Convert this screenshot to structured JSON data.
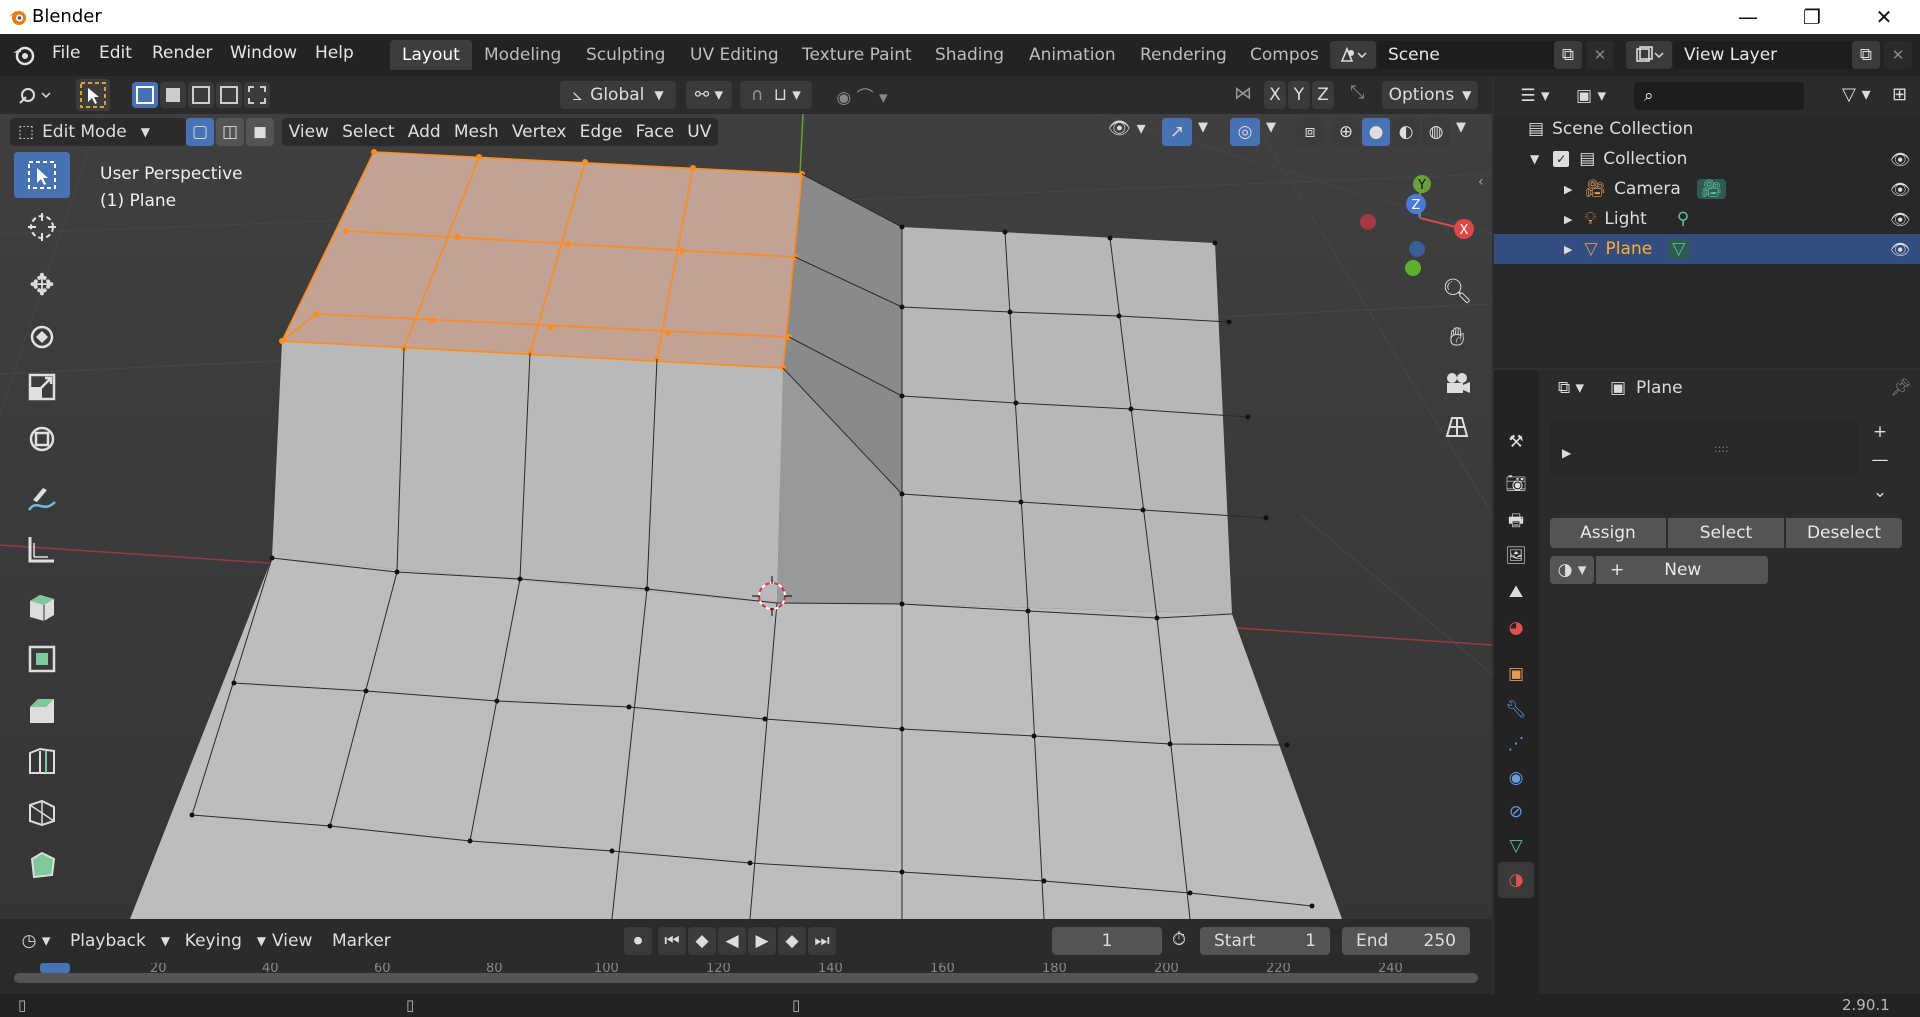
{
  "window": {
    "title": "Blender",
    "minimize": "—",
    "restore": "❐",
    "close": "✕"
  },
  "menu": [
    "File",
    "Edit",
    "Render",
    "Window",
    "Help"
  ],
  "workspaces": [
    "Layout",
    "Modeling",
    "Sculpting",
    "UV Editing",
    "Texture Paint",
    "Shading",
    "Animation",
    "Rendering",
    "Compos"
  ],
  "scene": {
    "name": "Scene",
    "view_layer": "View Layer"
  },
  "header1": {
    "orientation": "Global",
    "axes": [
      "X",
      "Y",
      "Z"
    ],
    "options": "Options"
  },
  "header2": {
    "mode": "Edit Mode",
    "items": [
      "View",
      "Select",
      "Add",
      "Mesh",
      "Vertex",
      "Edge",
      "Face",
      "UV"
    ]
  },
  "viewport": {
    "perspective": "User Perspective",
    "object": "(1) Plane"
  },
  "gizmo": {
    "x": "X",
    "y": "Y",
    "z": "Z"
  },
  "outliner": {
    "root": "Scene Collection",
    "collection": "Collection",
    "items": [
      "Camera",
      "Light",
      "Plane"
    ]
  },
  "properties": {
    "object_name": "Plane",
    "slot_buttons": {
      "assign": "Assign",
      "select": "Select",
      "deselect": "Deselect"
    },
    "new_label": "New",
    "list_grip": "::::"
  },
  "timeline": {
    "menus": [
      "Playback",
      "Keying",
      "View",
      "Marker"
    ],
    "current_frame": "1",
    "start_label": "Start",
    "start": "1",
    "end_label": "End",
    "end": "250",
    "ruler": [
      "20",
      "40",
      "60",
      "80",
      "100",
      "120",
      "140",
      "160",
      "180",
      "200",
      "220",
      "240"
    ]
  },
  "status": {
    "version": "2.90.1"
  },
  "colors": {
    "accent": "#4772b3",
    "selection": "#ff8c1a",
    "header": "#2b2b2b"
  }
}
